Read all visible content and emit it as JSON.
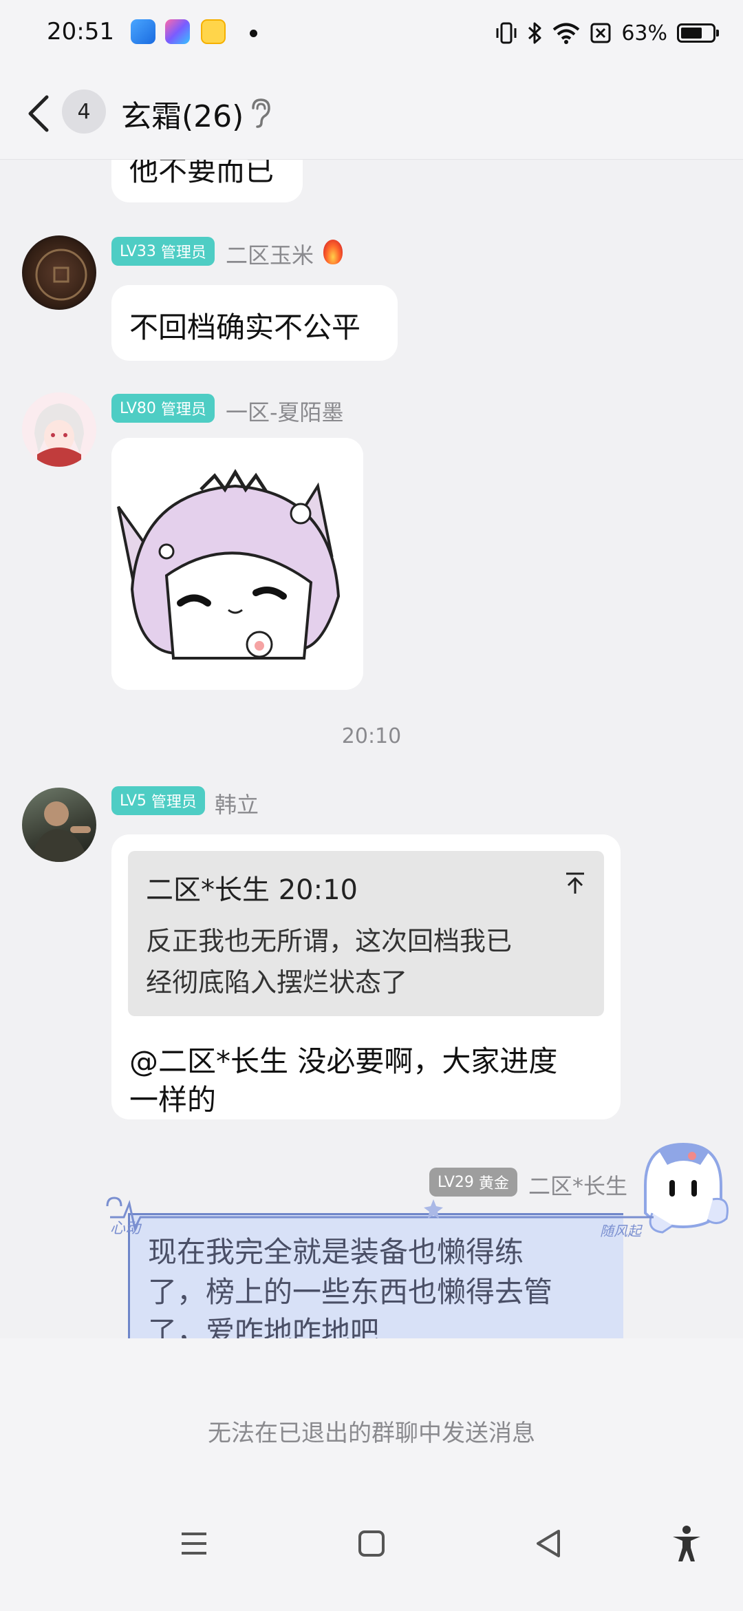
{
  "status_bar": {
    "time": "20:51",
    "battery_percent": "63%",
    "icons": [
      "vibrate-icon",
      "bluetooth-icon",
      "wifi-icon",
      "no-sim-icon",
      "battery-icon"
    ]
  },
  "header": {
    "unread_count": "4",
    "title": "玄霜(26)"
  },
  "messages": {
    "m0": {
      "text": "他不要而已"
    },
    "m1": {
      "level": "LV33",
      "role": "管理员",
      "nickname": "二区玉米",
      "text": "不回档确实不公平"
    },
    "m2": {
      "level": "LV80",
      "role": "管理员",
      "nickname": "一区-夏陌墨"
    },
    "time_separator": "20:10",
    "m3": {
      "level": "LV5",
      "role": "管理员",
      "nickname": "韩立",
      "quote_header": "二区*长生 20:10",
      "quote_line1": "反正我也无所谓，这次回档我已",
      "quote_line2": "经彻底陷入摆烂状态了",
      "reply_line1": "@二区*长生 没必要啊，大家进度",
      "reply_line2": "一样的"
    },
    "m4": {
      "level": "LV29",
      "role": "黄金",
      "nickname": "二区*长生",
      "line1": "现在我完全就是装备也懒得练",
      "line2": "了，榜上的一些东西也懒得去管",
      "line3": "了，爱咋地咋地吧",
      "frame_text_left": "心动",
      "frame_text_right": "随风起"
    }
  },
  "footer": {
    "notice": "无法在已退出的群聊中发送消息"
  },
  "colors": {
    "admin_badge": "#4ecdc4",
    "gold_badge": "#9e9e9e",
    "background": "#f1f1f3",
    "bubble": "#ffffff",
    "quote_bg": "#e6e6e6"
  }
}
